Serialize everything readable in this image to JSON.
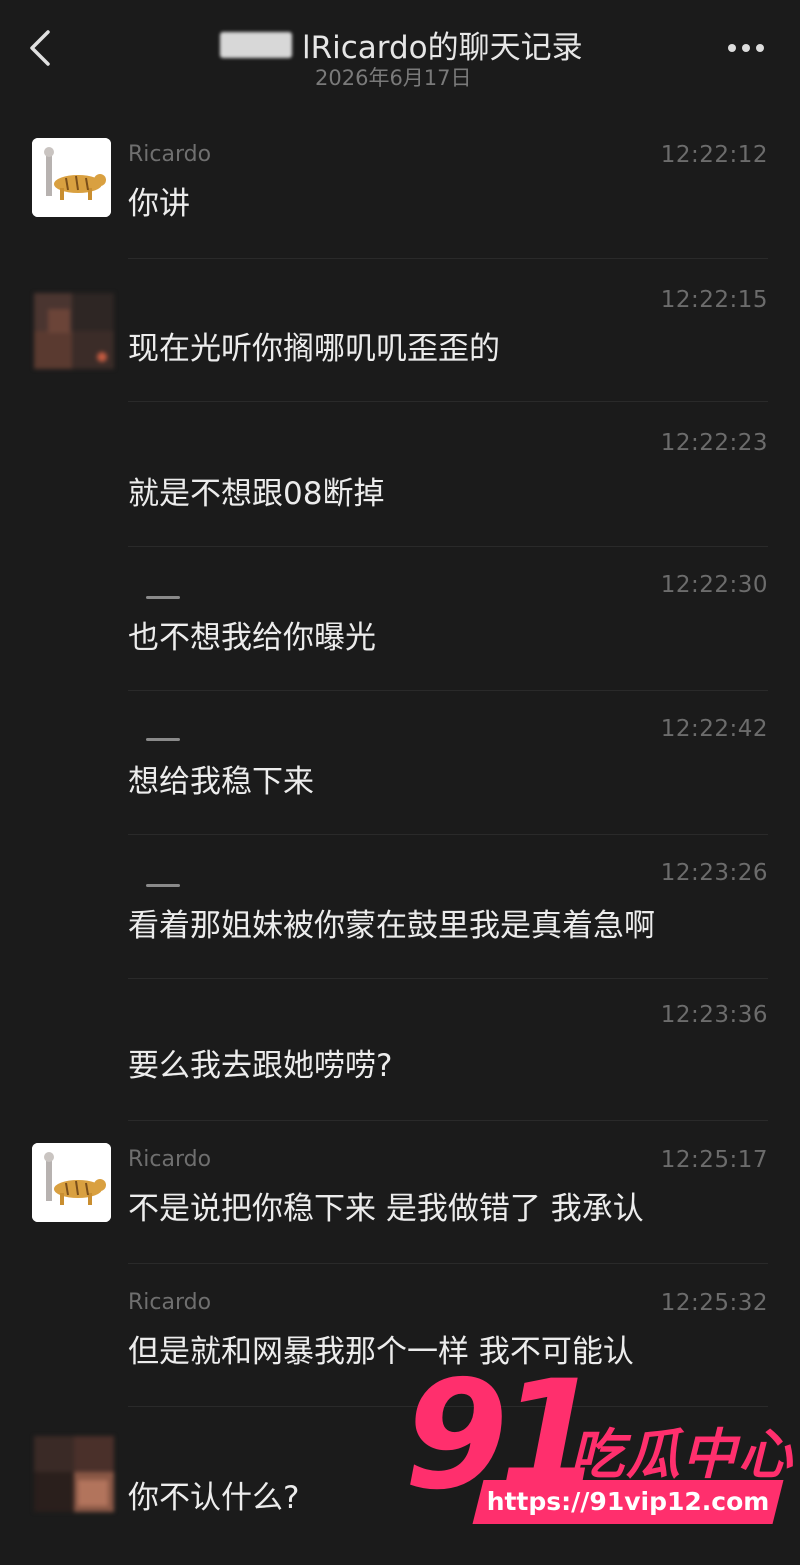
{
  "header": {
    "back_icon": "chevron-left-icon",
    "title": "lRicardo的聊天记录",
    "date": "2026年6月17日",
    "more_icon": "more-dots-icon"
  },
  "messages": [
    {
      "sender": "Ricardo",
      "time": "12:22:12",
      "text": "你讲"
    },
    {
      "sender": "",
      "time": "12:22:15",
      "text": "现在光听你搁哪叽叽歪歪的"
    },
    {
      "sender": "",
      "time": "12:22:23",
      "text": "就是不想跟08断掉"
    },
    {
      "sender": "",
      "time": "12:22:30",
      "text": "也不想我给你曝光"
    },
    {
      "sender": "",
      "time": "12:22:42",
      "text": "想给我稳下来"
    },
    {
      "sender": "",
      "time": "12:23:26",
      "text": "看着那姐妹被你蒙在鼓里我是真着急啊"
    },
    {
      "sender": "",
      "time": "12:23:36",
      "text": "要么我去跟她唠唠?"
    },
    {
      "sender": "Ricardo",
      "time": "12:25:17",
      "text": "不是说把你稳下来 是我做错了 我承认"
    },
    {
      "sender": "Ricardo",
      "time": "12:25:32",
      "text": "但是就和网暴我那个一样 我不可能认"
    },
    {
      "sender": "",
      "time": "",
      "text": "你不认什么?"
    }
  ],
  "watermark": {
    "number": "91",
    "brand": "吃瓜中心",
    "url": "https://91vip12.com"
  }
}
